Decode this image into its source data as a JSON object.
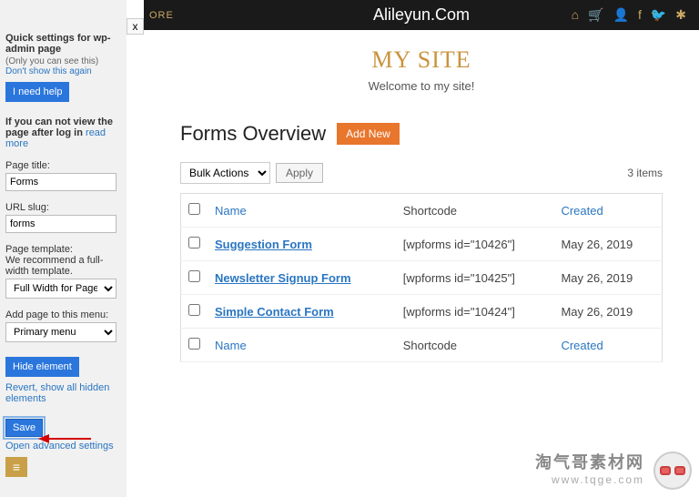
{
  "topbar": {
    "store": "ORE",
    "url": "Alileyun.Com",
    "icons": [
      "house-icon",
      "cart-icon",
      "user-icon",
      "facebook-icon",
      "twitter-icon",
      "rss-icon"
    ]
  },
  "sidebar": {
    "heading": "Quick settings for wp-admin page",
    "only_you": "(Only you can see this)",
    "dont_show": "Don't show this again",
    "need_help": "I need help",
    "cant_view": "If you can not view the page after log in",
    "read_more": "read more",
    "page_title_label": "Page title:",
    "page_title_value": "Forms",
    "url_slug_label": "URL slug:",
    "url_slug_value": "forms",
    "template_label": "Page template:",
    "template_note": "We recommend a full-width template.",
    "template_value": "Full Width for Page Builder",
    "menu_label": "Add page to this menu:",
    "menu_value": "Primary menu",
    "hide": "Hide element",
    "revert": "Revert, show all hidden elements",
    "save": "Save",
    "advanced": "Open advanced settings"
  },
  "header": {
    "title": "MY SITE",
    "tagline": "Welcome to my site!"
  },
  "forms": {
    "heading": "Forms Overview",
    "add_new": "Add New",
    "bulk": "Bulk Actions",
    "apply": "Apply",
    "count": "3 items",
    "cols": {
      "name": "Name",
      "shortcode": "Shortcode",
      "created": "Created"
    },
    "rows": [
      {
        "name": "Suggestion Form",
        "shortcode": "[wpforms id=\"10426\"]",
        "created": "May 26, 2019"
      },
      {
        "name": "Newsletter Signup Form",
        "shortcode": "[wpforms id=\"10425\"]",
        "created": "May 26, 2019"
      },
      {
        "name": "Simple Contact Form",
        "shortcode": "[wpforms id=\"10424\"]",
        "created": "May 26, 2019"
      }
    ]
  },
  "watermark": {
    "cn": "淘气哥素材网",
    "url": "www.tqge.com"
  }
}
